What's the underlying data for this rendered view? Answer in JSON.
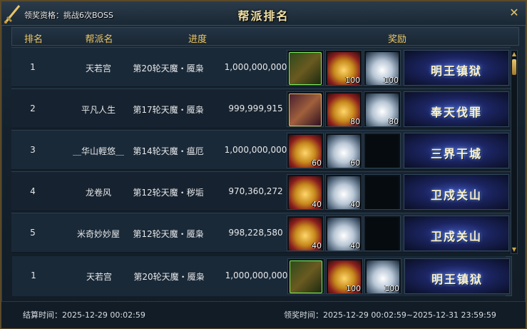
{
  "window": {
    "title": "帮派排名",
    "qualification": "领奖资格：挑战6次BOSS",
    "close_icon": "close-icon"
  },
  "columns": {
    "rank": "排名",
    "guild": "帮派名",
    "progress": "进度",
    "reward": "奖励"
  },
  "rows": [
    {
      "rank": "1",
      "guild": "天若宫",
      "progress": "第20轮天魔・魇枭",
      "value": "1,000,000,000",
      "items": [
        {
          "type": "hero",
          "icon": "hero-portrait-icon",
          "count": ""
        },
        {
          "type": "gold",
          "icon": "gold-chest-icon",
          "count": "100"
        },
        {
          "type": "silver",
          "icon": "silver-chest-icon",
          "count": "100"
        }
      ],
      "title_badge": "明王镇狱"
    },
    {
      "rank": "2",
      "guild": "平凡人生",
      "progress": "第17轮天魔・魇枭",
      "value": "999,999,915",
      "items": [
        {
          "type": "hero2",
          "icon": "hero-portrait-icon",
          "count": ""
        },
        {
          "type": "gold",
          "icon": "gold-chest-icon",
          "count": "80"
        },
        {
          "type": "silver",
          "icon": "silver-chest-icon",
          "count": "80"
        }
      ],
      "title_badge": "奉天伐罪"
    },
    {
      "rank": "3",
      "guild": "＿华山輕悠＿",
      "progress": "第14轮天魔・瘟厄",
      "value": "1,000,000,000",
      "items": [
        {
          "type": "gold",
          "icon": "gold-chest-icon",
          "count": "60"
        },
        {
          "type": "silver",
          "icon": "silver-chest-icon",
          "count": "60"
        },
        {
          "type": "empty",
          "icon": "empty-slot-icon",
          "count": ""
        }
      ],
      "title_badge": "三界干城"
    },
    {
      "rank": "4",
      "guild": "龙卷风",
      "progress": "第12轮天魔・秽垢",
      "value": "970,360,272",
      "items": [
        {
          "type": "gold",
          "icon": "gold-chest-icon",
          "count": "40"
        },
        {
          "type": "silver",
          "icon": "silver-chest-icon",
          "count": "40"
        },
        {
          "type": "empty",
          "icon": "empty-slot-icon",
          "count": ""
        }
      ],
      "title_badge": "卫戍关山"
    },
    {
      "rank": "5",
      "guild": "米奇妙妙屋",
      "progress": "第12轮天魔・魇枭",
      "value": "998,228,580",
      "items": [
        {
          "type": "gold",
          "icon": "gold-chest-icon",
          "count": "40"
        },
        {
          "type": "silver",
          "icon": "silver-chest-icon",
          "count": "40"
        },
        {
          "type": "empty",
          "icon": "empty-slot-icon",
          "count": ""
        }
      ],
      "title_badge": "卫戍关山"
    }
  ],
  "my_row": {
    "rank": "1",
    "guild": "天若宫",
    "progress": "第20轮天魔・魇枭",
    "value": "1,000,000,000",
    "items": [
      {
        "type": "hero",
        "icon": "hero-portrait-icon",
        "count": ""
      },
      {
        "type": "gold",
        "icon": "gold-chest-icon",
        "count": "100"
      },
      {
        "type": "silver",
        "icon": "silver-chest-icon",
        "count": "100"
      }
    ],
    "title_badge": "明王镇狱"
  },
  "footer": {
    "settle_time": "结算时间：2025-12-29 00:02:59",
    "claim_time": "领奖时间：2025-12-29 00:02:59~2025-12-31 23:59:59"
  }
}
